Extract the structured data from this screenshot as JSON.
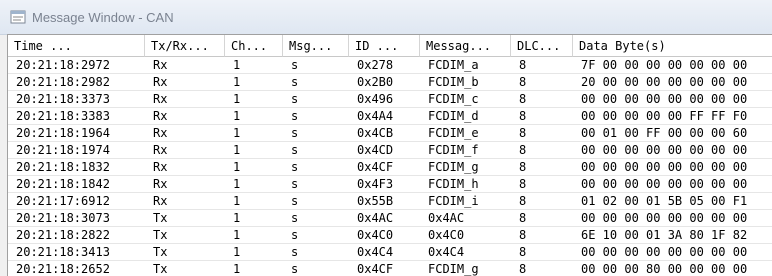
{
  "window": {
    "title": "Message Window - CAN"
  },
  "columns": [
    "Time ...",
    "Tx/Rx...",
    "Ch...",
    "Msg...",
    "ID ...",
    "Messag...",
    "DLC...",
    "Data Byte(s)"
  ],
  "rows": [
    [
      "20:21:18:2972",
      "Rx",
      "1",
      "s",
      "0x278",
      "FCDIM_a",
      "8",
      "7F 00 00 00 00 00 00 00"
    ],
    [
      "20:21:18:2982",
      "Rx",
      "1",
      "s",
      "0x2B0",
      "FCDIM_b",
      "8",
      "20 00 00 00 00 00 00 00"
    ],
    [
      "20:21:18:3373",
      "Rx",
      "1",
      "s",
      "0x496",
      "FCDIM_c",
      "8",
      "00 00 00 00 00 00 00 00"
    ],
    [
      "20:21:18:3383",
      "Rx",
      "1",
      "s",
      "0x4A4",
      "FCDIM_d",
      "8",
      "00 00 00 00 00 FF FF F0"
    ],
    [
      "20:21:18:1964",
      "Rx",
      "1",
      "s",
      "0x4CB",
      "FCDIM_e",
      "8",
      "00 01 00 FF 00 00 00 60"
    ],
    [
      "20:21:18:1974",
      "Rx",
      "1",
      "s",
      "0x4CD",
      "FCDIM_f",
      "8",
      "00 00 00 00 00 00 00 00"
    ],
    [
      "20:21:18:1832",
      "Rx",
      "1",
      "s",
      "0x4CF",
      "FCDIM_g",
      "8",
      "00 00 00 00 00 00 00 00"
    ],
    [
      "20:21:18:1842",
      "Rx",
      "1",
      "s",
      "0x4F3",
      "FCDIM_h",
      "8",
      "00 00 00 00 00 00 00 00"
    ],
    [
      "20:21:17:6912",
      "Rx",
      "1",
      "s",
      "0x55B",
      "FCDIM_i",
      "8",
      "01 02 00 01 5B 05 00 F1"
    ],
    [
      "20:21:18:3073",
      "Tx",
      "1",
      "s",
      "0x4AC",
      "0x4AC",
      "8",
      "00 00 00 00 00 00 00 00"
    ],
    [
      "20:21:18:2822",
      "Tx",
      "1",
      "s",
      "0x4C0",
      "0x4C0",
      "8",
      "6E 10 00 01 3A 80 1F 82"
    ],
    [
      "20:21:18:3413",
      "Tx",
      "1",
      "s",
      "0x4C4",
      "0x4C4",
      "8",
      "00 00 00 00 00 00 00 00"
    ],
    [
      "20:21:18:2652",
      "Tx",
      "1",
      "s",
      "0x4CF",
      "FCDIM_g",
      "8",
      "00 00 00 80 00 00 00 00"
    ]
  ]
}
